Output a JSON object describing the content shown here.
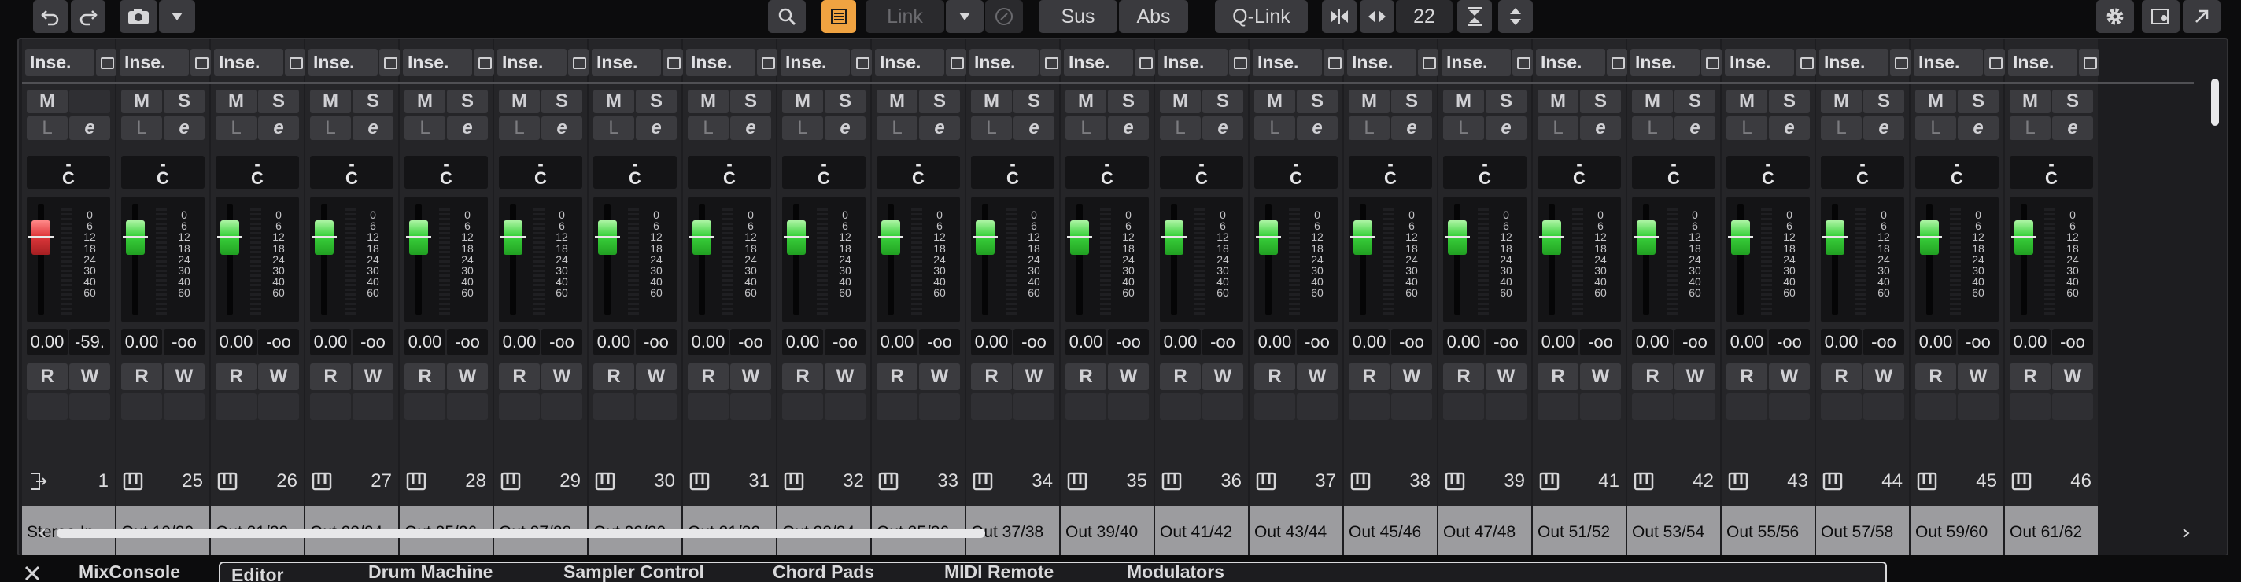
{
  "toolbar": {
    "link_label": "Link",
    "sus_label": "Sus",
    "abs_label": "Abs",
    "qlink_label": "Q-Link",
    "channel_count": "22"
  },
  "channels": [
    {
      "name": "Stereo In",
      "number": "1",
      "insert": "Inse.",
      "volume": "0.00",
      "peak": "-59.",
      "type": "input",
      "meter_color": "#e0383c"
    },
    {
      "name": "Out 19/20",
      "number": "25",
      "insert": "Inse.",
      "volume": "0.00",
      "peak": "-oo",
      "type": "instrument",
      "meter_color": "#3ad23c"
    },
    {
      "name": "Out 21/22",
      "number": "26",
      "insert": "Inse.",
      "volume": "0.00",
      "peak": "-oo",
      "type": "instrument",
      "meter_color": "#3ad23c"
    },
    {
      "name": "Out 23/24",
      "number": "27",
      "insert": "Inse.",
      "volume": "0.00",
      "peak": "-oo",
      "type": "instrument",
      "meter_color": "#3ad23c"
    },
    {
      "name": "Out 25/26",
      "number": "28",
      "insert": "Inse.",
      "volume": "0.00",
      "peak": "-oo",
      "type": "instrument",
      "meter_color": "#3ad23c"
    },
    {
      "name": "Out 27/28",
      "number": "29",
      "insert": "Inse.",
      "volume": "0.00",
      "peak": "-oo",
      "type": "instrument",
      "meter_color": "#3ad23c"
    },
    {
      "name": "Out 29/30",
      "number": "30",
      "insert": "Inse.",
      "volume": "0.00",
      "peak": "-oo",
      "type": "instrument",
      "meter_color": "#3ad23c"
    },
    {
      "name": "Out 31/32",
      "number": "31",
      "insert": "Inse.",
      "volume": "0.00",
      "peak": "-oo",
      "type": "instrument",
      "meter_color": "#3ad23c"
    },
    {
      "name": "Out 33/34",
      "number": "32",
      "insert": "Inse.",
      "volume": "0.00",
      "peak": "-oo",
      "type": "instrument",
      "meter_color": "#3ad23c"
    },
    {
      "name": "Out 35/36",
      "number": "33",
      "insert": "Inse.",
      "volume": "0.00",
      "peak": "-oo",
      "type": "instrument",
      "meter_color": "#3ad23c"
    },
    {
      "name": "Out 37/38",
      "number": "34",
      "insert": "Inse.",
      "volume": "0.00",
      "peak": "-oo",
      "type": "instrument",
      "meter_color": "#3ad23c"
    },
    {
      "name": "Out 39/40",
      "number": "35",
      "insert": "Inse.",
      "volume": "0.00",
      "peak": "-oo",
      "type": "instrument",
      "meter_color": "#3ad23c"
    },
    {
      "name": "Out 41/42",
      "number": "36",
      "insert": "Inse.",
      "volume": "0.00",
      "peak": "-oo",
      "type": "instrument",
      "meter_color": "#3ad23c"
    },
    {
      "name": "Out 43/44",
      "number": "37",
      "insert": "Inse.",
      "volume": "0.00",
      "peak": "-oo",
      "type": "instrument",
      "meter_color": "#3ad23c"
    },
    {
      "name": "Out 45/46",
      "number": "38",
      "insert": "Inse.",
      "volume": "0.00",
      "peak": "-oo",
      "type": "instrument",
      "meter_color": "#3ad23c"
    },
    {
      "name": "Out 47/48",
      "number": "39",
      "insert": "Inse.",
      "volume": "0.00",
      "peak": "-oo",
      "type": "instrument",
      "meter_color": "#3ad23c"
    },
    {
      "name": "Out 51/52",
      "number": "41",
      "insert": "Inse.",
      "volume": "0.00",
      "peak": "-oo",
      "type": "instrument",
      "meter_color": "#3ad23c"
    },
    {
      "name": "Out 53/54",
      "number": "42",
      "insert": "Inse.",
      "volume": "0.00",
      "peak": "-oo",
      "type": "instrument",
      "meter_color": "#3ad23c"
    },
    {
      "name": "Out 55/56",
      "number": "43",
      "insert": "Inse.",
      "volume": "0.00",
      "peak": "-oo",
      "type": "instrument",
      "meter_color": "#3ad23c"
    },
    {
      "name": "Out 57/58",
      "number": "44",
      "insert": "Inse.",
      "volume": "0.00",
      "peak": "-oo",
      "type": "instrument",
      "meter_color": "#3ad23c"
    },
    {
      "name": "Out 59/60",
      "number": "45",
      "insert": "Inse.",
      "volume": "0.00",
      "peak": "-oo",
      "type": "instrument",
      "meter_color": "#3ad23c"
    },
    {
      "name": "Out 61/62",
      "number": "46",
      "insert": "Inse.",
      "volume": "0.00",
      "peak": "-oo",
      "type": "instrument",
      "meter_color": "#3ad23c"
    }
  ],
  "channel_buttons": {
    "mute": "M",
    "solo": "S",
    "listen": "L",
    "edit": "e",
    "read": "R",
    "write": "W",
    "pan": "C"
  },
  "fader_scale": [
    "0",
    "6",
    "12",
    "18",
    "24",
    "30",
    "40",
    "60"
  ],
  "tabs": [
    "MixConsole",
    "Editor",
    "Drum Machine",
    "Sampler Control",
    "Chord Pads",
    "MIDI Remote",
    "Modulators"
  ],
  "active_tab": "MixConsole"
}
